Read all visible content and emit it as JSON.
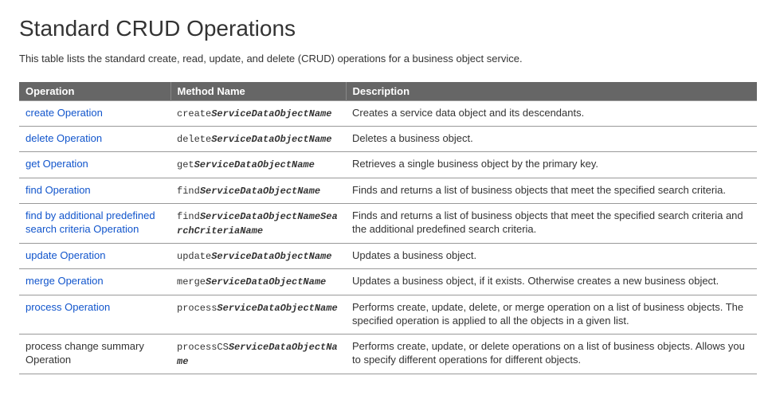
{
  "title": "Standard CRUD Operations",
  "intro": "This table lists the standard create, read, update, and delete (CRUD) operations for a business object service.",
  "table": {
    "headers": {
      "operation": "Operation",
      "method": "Method Name",
      "description": "Description"
    },
    "rows": [
      {
        "operation": "create Operation",
        "is_link": true,
        "method_prefix": "create",
        "method_suffix": "ServiceDataObjectName",
        "description": "Creates a service data object and its descendants."
      },
      {
        "operation": "delete Operation",
        "is_link": true,
        "method_prefix": "delete",
        "method_suffix": "ServiceDataObjectName",
        "description": "Deletes a business object."
      },
      {
        "operation": "get Operation",
        "is_link": true,
        "method_prefix": "get",
        "method_suffix": "ServiceDataObjectName",
        "description": "Retrieves a single business object by the primary key."
      },
      {
        "operation": "find Operation",
        "is_link": true,
        "method_prefix": "find",
        "method_suffix": "ServiceDataObjectName",
        "description": "Finds and returns a list of business objects that meet the specified search criteria."
      },
      {
        "operation": "find by additional predefined search criteria Operation",
        "is_link": true,
        "method_prefix": "find",
        "method_suffix": "ServiceDataObjectNameSearchCriteriaName",
        "description": "Finds and returns a list of business objects that meet the specified search criteria and the additional predefined search criteria."
      },
      {
        "operation": "update Operation",
        "is_link": true,
        "method_prefix": "update",
        "method_suffix": "ServiceDataObjectName",
        "description": "Updates a business object."
      },
      {
        "operation": "merge Operation",
        "is_link": true,
        "method_prefix": "merge",
        "method_suffix": "ServiceDataObjectName",
        "description": "Updates a business object, if it exists. Otherwise creates a new business object."
      },
      {
        "operation": "process Operation",
        "is_link": true,
        "method_prefix": "process",
        "method_suffix": "ServiceDataObjectName",
        "description": "Performs create, update, delete, or merge operation on a list of business objects. The specified operation is applied to all the objects in a given list."
      },
      {
        "operation": "process change summary Operation",
        "is_link": false,
        "method_prefix": "processCS",
        "method_suffix": "ServiceDataObjectName",
        "description": "Performs create, update, or delete operations on a list of business objects. Allows you to specify different operations for different objects."
      }
    ]
  }
}
